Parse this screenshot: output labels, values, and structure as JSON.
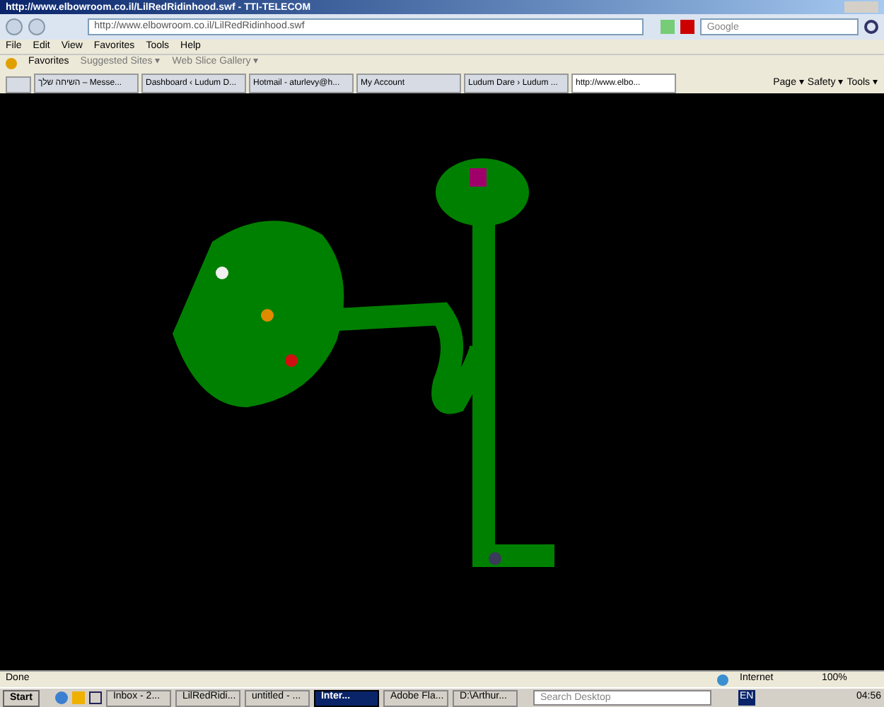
{
  "window": {
    "title": "http://www.elbowroom.co.il/LilRedRidinhood.swf - TTI-TELECOM"
  },
  "address_bar": {
    "value": "http://www.elbowroom.co.il/LilRedRidinhood.swf"
  },
  "search": {
    "placeholder": "Google"
  },
  "menu": [
    "File",
    "Edit",
    "View",
    "Favorites",
    "Tools",
    "Help"
  ],
  "favorites_bar": {
    "label": "Favorites",
    "links": [
      "Suggested Sites ▾",
      "Web Slice Gallery ▾"
    ]
  },
  "tabs": [
    {
      "label": "השיחה שלך – Messe...",
      "selected": false
    },
    {
      "label": "Dashboard ‹ Ludum D...",
      "selected": false
    },
    {
      "label": "Hotmail - aturlevy@h...",
      "selected": false
    },
    {
      "label": "My Account",
      "selected": false
    },
    {
      "label": "Ludum Dare › Ludum ...",
      "selected": false
    },
    {
      "label": "http://www.elbo...",
      "selected": true
    }
  ],
  "command_bar": [
    "Page ▾",
    "Safety ▾",
    "Tools ▾"
  ],
  "game": {
    "dots": [
      {
        "color": "#f0f0f0"
      },
      {
        "color": "#e08a00"
      },
      {
        "color": "#d01010"
      },
      {
        "color": "#3a3a5a"
      }
    ]
  },
  "status_bar": {
    "text": "Done",
    "zone": "Internet",
    "zoom": "100%"
  },
  "taskbar": {
    "start": "Start",
    "items": [
      {
        "label": "Inbox - 2...",
        "selected": false
      },
      {
        "label": "LilRedRidi...",
        "selected": false
      },
      {
        "label": "untitled - ...",
        "selected": false
      },
      {
        "label": "Inter...",
        "selected": true
      },
      {
        "label": "Adobe Fla...",
        "selected": false
      },
      {
        "label": "D:\\Arthur...",
        "selected": false
      }
    ],
    "search_placeholder": "Search Desktop",
    "language": "EN",
    "time": "04:56"
  }
}
